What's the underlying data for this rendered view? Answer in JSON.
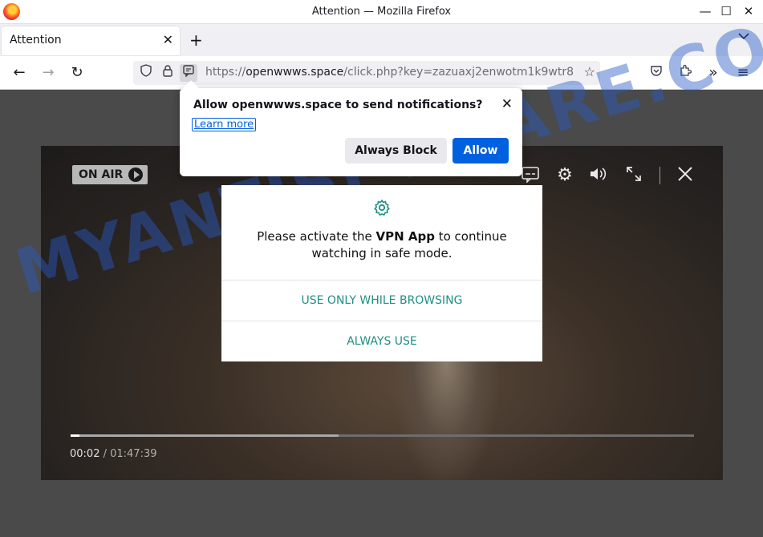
{
  "window": {
    "title": "Attention — Mozilla Firefox",
    "minimize": "—",
    "maximize": "☐",
    "close": "✕"
  },
  "tabs": [
    {
      "label": "Attention",
      "close": "✕"
    }
  ],
  "tabstrip": {
    "new_tab": "+",
    "list": "⌄"
  },
  "navbar": {
    "back": "←",
    "forward": "→",
    "reload": "↻",
    "url_prefix": "https://",
    "url_host": "openwwws.space",
    "url_path": "/click.php?key=zazuaxj2enwotm1k9wtr8",
    "icons": [
      "shield-icon",
      "lock-icon",
      "notification-permission-icon",
      "bookmark-star-icon",
      "pocket-icon",
      "extensions-icon",
      "overflow-icon",
      "menu-icon"
    ]
  },
  "notification": {
    "title": "Allow openwwws.space to send notifications?",
    "learn_more": "Learn more",
    "block_label": "Always Block",
    "allow_label": "Allow"
  },
  "player": {
    "on_air": "ON AIR",
    "current_time": "00:02",
    "total_time": " / 01:47:39",
    "progress_played": 0.014,
    "progress_buffered": 0.43
  },
  "modal": {
    "text_part1": "Please activate the ",
    "text_bold": "VPN App",
    "text_part2": " to continue watching in safe mode.",
    "button_primary": "USE ONLY WHILE BROWSING",
    "button_secondary": "ALWAYS USE",
    "accent_color": "#1f8f84"
  },
  "watermark": "MYANTISPYWARE.COM",
  "colors": {
    "allow_button": "#0061e0",
    "link": "#0061e0"
  }
}
